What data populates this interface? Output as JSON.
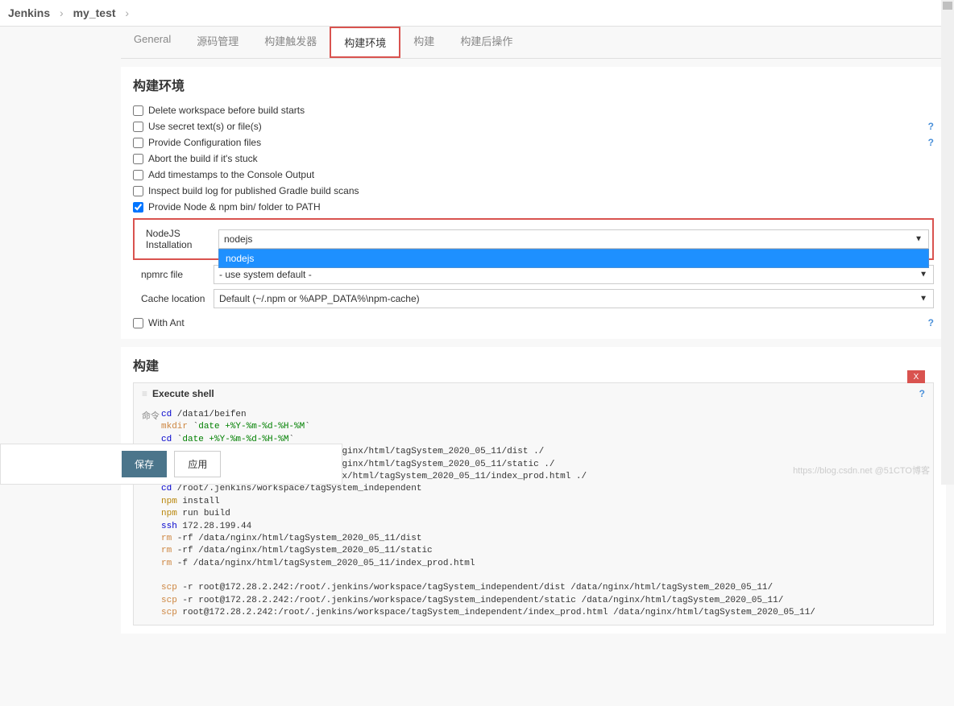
{
  "breadcrumb": {
    "item1": "Jenkins",
    "item2": "my_test"
  },
  "tabs": [
    {
      "label": "General"
    },
    {
      "label": "源码管理"
    },
    {
      "label": "构建触发器"
    },
    {
      "label": "构建环境"
    },
    {
      "label": "构建"
    },
    {
      "label": "构建后操作"
    }
  ],
  "activeTab": 3,
  "sectionEnv": {
    "title": "构建环境",
    "checks": [
      {
        "label": "Delete workspace before build starts",
        "checked": false,
        "help": false
      },
      {
        "label": "Use secret text(s) or file(s)",
        "checked": false,
        "help": true
      },
      {
        "label": "Provide Configuration files",
        "checked": false,
        "help": true
      },
      {
        "label": "Abort the build if it's stuck",
        "checked": false,
        "help": false
      },
      {
        "label": "Add timestamps to the Console Output",
        "checked": false,
        "help": false
      },
      {
        "label": "Inspect build log for published Gradle build scans",
        "checked": false,
        "help": false
      },
      {
        "label": "Provide Node & npm bin/ folder to PATH",
        "checked": true,
        "help": false
      }
    ],
    "nodejs": {
      "label": "NodeJS Installation",
      "selected": "nodejs",
      "options": [
        "nodejs"
      ]
    },
    "npmrc": {
      "label": "npmrc file",
      "selected": "- use system default -"
    },
    "cache": {
      "label": "Cache location",
      "selected": "Default (~/.npm or %APP_DATA%\\npm-cache)"
    },
    "withAnt": {
      "label": "With Ant",
      "checked": false,
      "help": true
    }
  },
  "sectionBuild": {
    "title": "构建",
    "shell": {
      "title": "Execute shell",
      "iconLabel": "命令",
      "code": [
        {
          "cls": "c-cd",
          "pre": "cd",
          "txt": " /data1/beifen"
        },
        {
          "cls": "c-mkdir",
          "pre": "mkdir",
          "txt": " `",
          "date": "date +%Y-%m-%d-%H-%M",
          "post": "`"
        },
        {
          "cls": "c-cd",
          "pre": "cd",
          "txt": " `",
          "date": "date +%Y-%m-%d-%H-%M",
          "post": "`"
        },
        {
          "cls": "c-scp",
          "pre": "scp",
          "txt": " -r root@172.28.199.44:/data1/nginx/html/tagSystem_2020_05_11/dist ./"
        },
        {
          "cls": "c-scp",
          "pre": "scp",
          "txt": " -r root@172.28.199.44:/data1/nginx/html/tagSystem_2020_05_11/static ./"
        },
        {
          "cls": "c-scp",
          "pre": "scp",
          "txt": " root@172.28.199.44:/data1/nginx/html/tagSystem_2020_05_11/index_prod.html ./"
        },
        {
          "cls": "c-cd",
          "pre": "cd",
          "txt": " /root/.jenkins/workspace/tagSystem_independent"
        },
        {
          "cls": "c-npm",
          "pre": "npm",
          "txt": " install"
        },
        {
          "cls": "c-npm",
          "pre": "npm",
          "txt": " run build"
        },
        {
          "cls": "c-ssh",
          "pre": "ssh",
          "txt": " 172.28.199.44"
        },
        {
          "cls": "c-rm",
          "pre": "rm",
          "txt": " -rf /data/nginx/html/tagSystem_2020_05_11/dist"
        },
        {
          "cls": "c-rm",
          "pre": "rm",
          "txt": " -rf /data/nginx/html/tagSystem_2020_05_11/static"
        },
        {
          "cls": "c-rm",
          "pre": "rm",
          "txt": " -f /data/nginx/html/tagSystem_2020_05_11/index_prod.html"
        },
        {
          "cls": "",
          "pre": "",
          "txt": " "
        },
        {
          "cls": "c-scp",
          "pre": "scp",
          "txt": " -r root@172.28.2.242:/root/.jenkins/workspace/tagSystem_independent/dist /data/nginx/html/tagSystem_2020_05_11/"
        },
        {
          "cls": "c-scp",
          "pre": "scp",
          "txt": " -r root@172.28.2.242:/root/.jenkins/workspace/tagSystem_independent/static /data/nginx/html/tagSystem_2020_05_11/"
        },
        {
          "cls": "c-scp",
          "pre": "scp",
          "txt": " root@172.28.2.242:/root/.jenkins/workspace/tagSystem_independent/index_prod.html /data/nginx/html/tagSystem_2020_05_11/"
        }
      ]
    }
  },
  "buttons": {
    "save": "保存",
    "apply": "应用"
  },
  "watermark": "https://blog.csdn.net @51CTO博客"
}
